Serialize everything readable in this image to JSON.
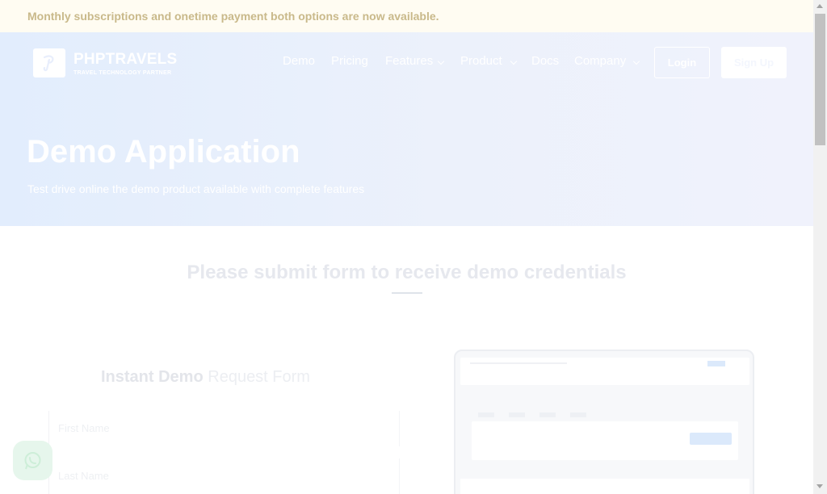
{
  "announcement": {
    "text": "Monthly subscriptions and onetime payment both options are now available."
  },
  "header": {
    "logo": {
      "name": "PHPTRAVELS",
      "tagline": "TRAVEL TECHNOLOGY PARTNER",
      "icon": "phptravels-logo-icon"
    },
    "nav": [
      {
        "label": "Demo",
        "dropdown": false
      },
      {
        "label": "Pricing",
        "dropdown": false
      },
      {
        "label": "Features",
        "dropdown": true
      },
      {
        "label": "Product",
        "dropdown": true
      },
      {
        "label": "Docs",
        "dropdown": false
      },
      {
        "label": "Company",
        "dropdown": true
      }
    ],
    "login_label": "Login",
    "signup_label": "Sign Up"
  },
  "hero": {
    "title": "Demo Application",
    "subtitle": "Test drive online the demo product available with complete features"
  },
  "section": {
    "title": "Please submit form to receive demo credentials"
  },
  "form": {
    "title_bold": "Instant Demo",
    "title_light": "Request Form",
    "fields": [
      {
        "placeholder": "First Name"
      },
      {
        "placeholder": "Last Name"
      }
    ]
  },
  "widgets": {
    "chat_icon": "whatsapp-icon"
  },
  "colors": {
    "announcement_bg": "#fffcf2",
    "hero_bg": "#e2edfd",
    "brand": "#0d6efd"
  }
}
